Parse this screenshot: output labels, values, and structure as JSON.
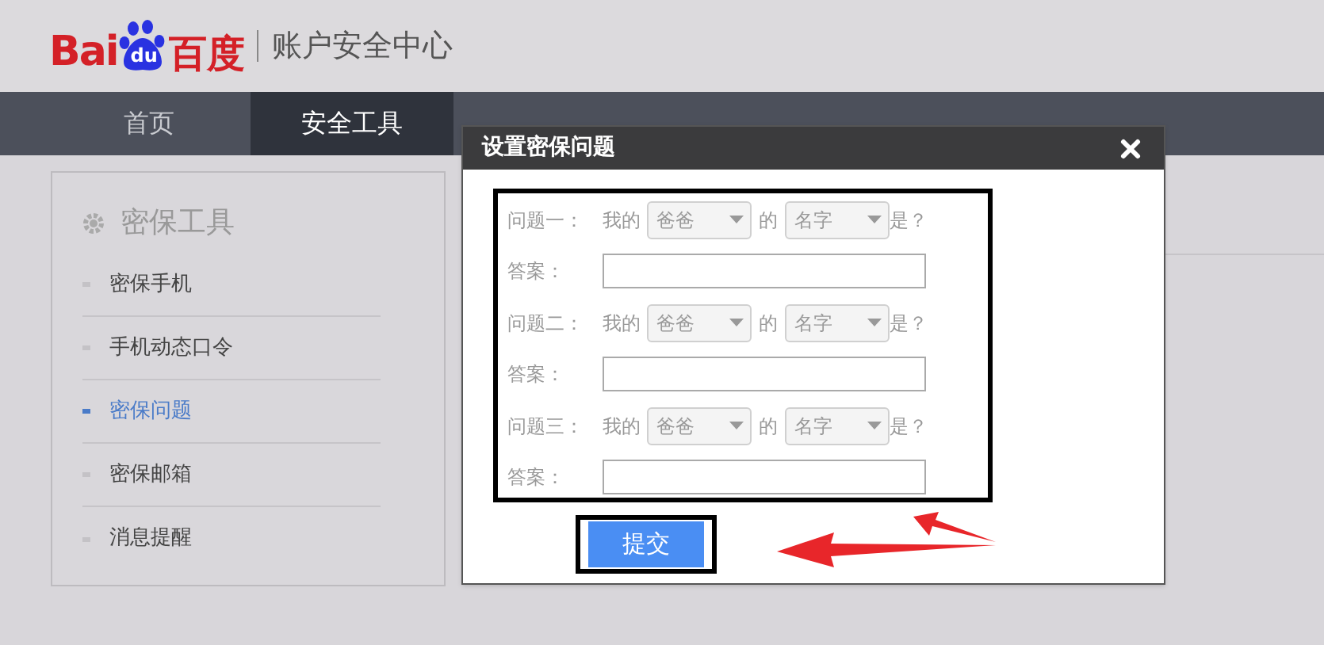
{
  "header": {
    "logo": {
      "left": "Bai",
      "paw": "du",
      "right": "百度"
    },
    "site_title": "账户安全中心"
  },
  "nav": {
    "tabs": [
      {
        "label": "首页",
        "selected": false
      },
      {
        "label": "安全工具",
        "selected": true
      }
    ]
  },
  "sidebar": {
    "title": "密保工具",
    "items": [
      {
        "label": "密保手机",
        "selected": false
      },
      {
        "label": "手机动态口令",
        "selected": false
      },
      {
        "label": "密保问题",
        "selected": true
      },
      {
        "label": "密保邮箱",
        "selected": false
      },
      {
        "label": "消息提醒",
        "selected": false
      }
    ]
  },
  "dialog": {
    "title": "设置密保问题",
    "questions": [
      {
        "label": "问题一：",
        "prefix": "我的",
        "select_1": "爸爸",
        "joiner": "的",
        "select_2": "名字",
        "suffix": "是？",
        "answer_label": "答案："
      },
      {
        "label": "问题二：",
        "prefix": "我的",
        "select_1": "爸爸",
        "joiner": "的",
        "select_2": "名字",
        "suffix": "是？",
        "answer_label": "答案："
      },
      {
        "label": "问题三：",
        "prefix": "我的",
        "select_1": "爸爸",
        "joiner": "的",
        "select_2": "名字",
        "suffix": "是？",
        "answer_label": "答案："
      }
    ],
    "submit": "提交"
  }
}
